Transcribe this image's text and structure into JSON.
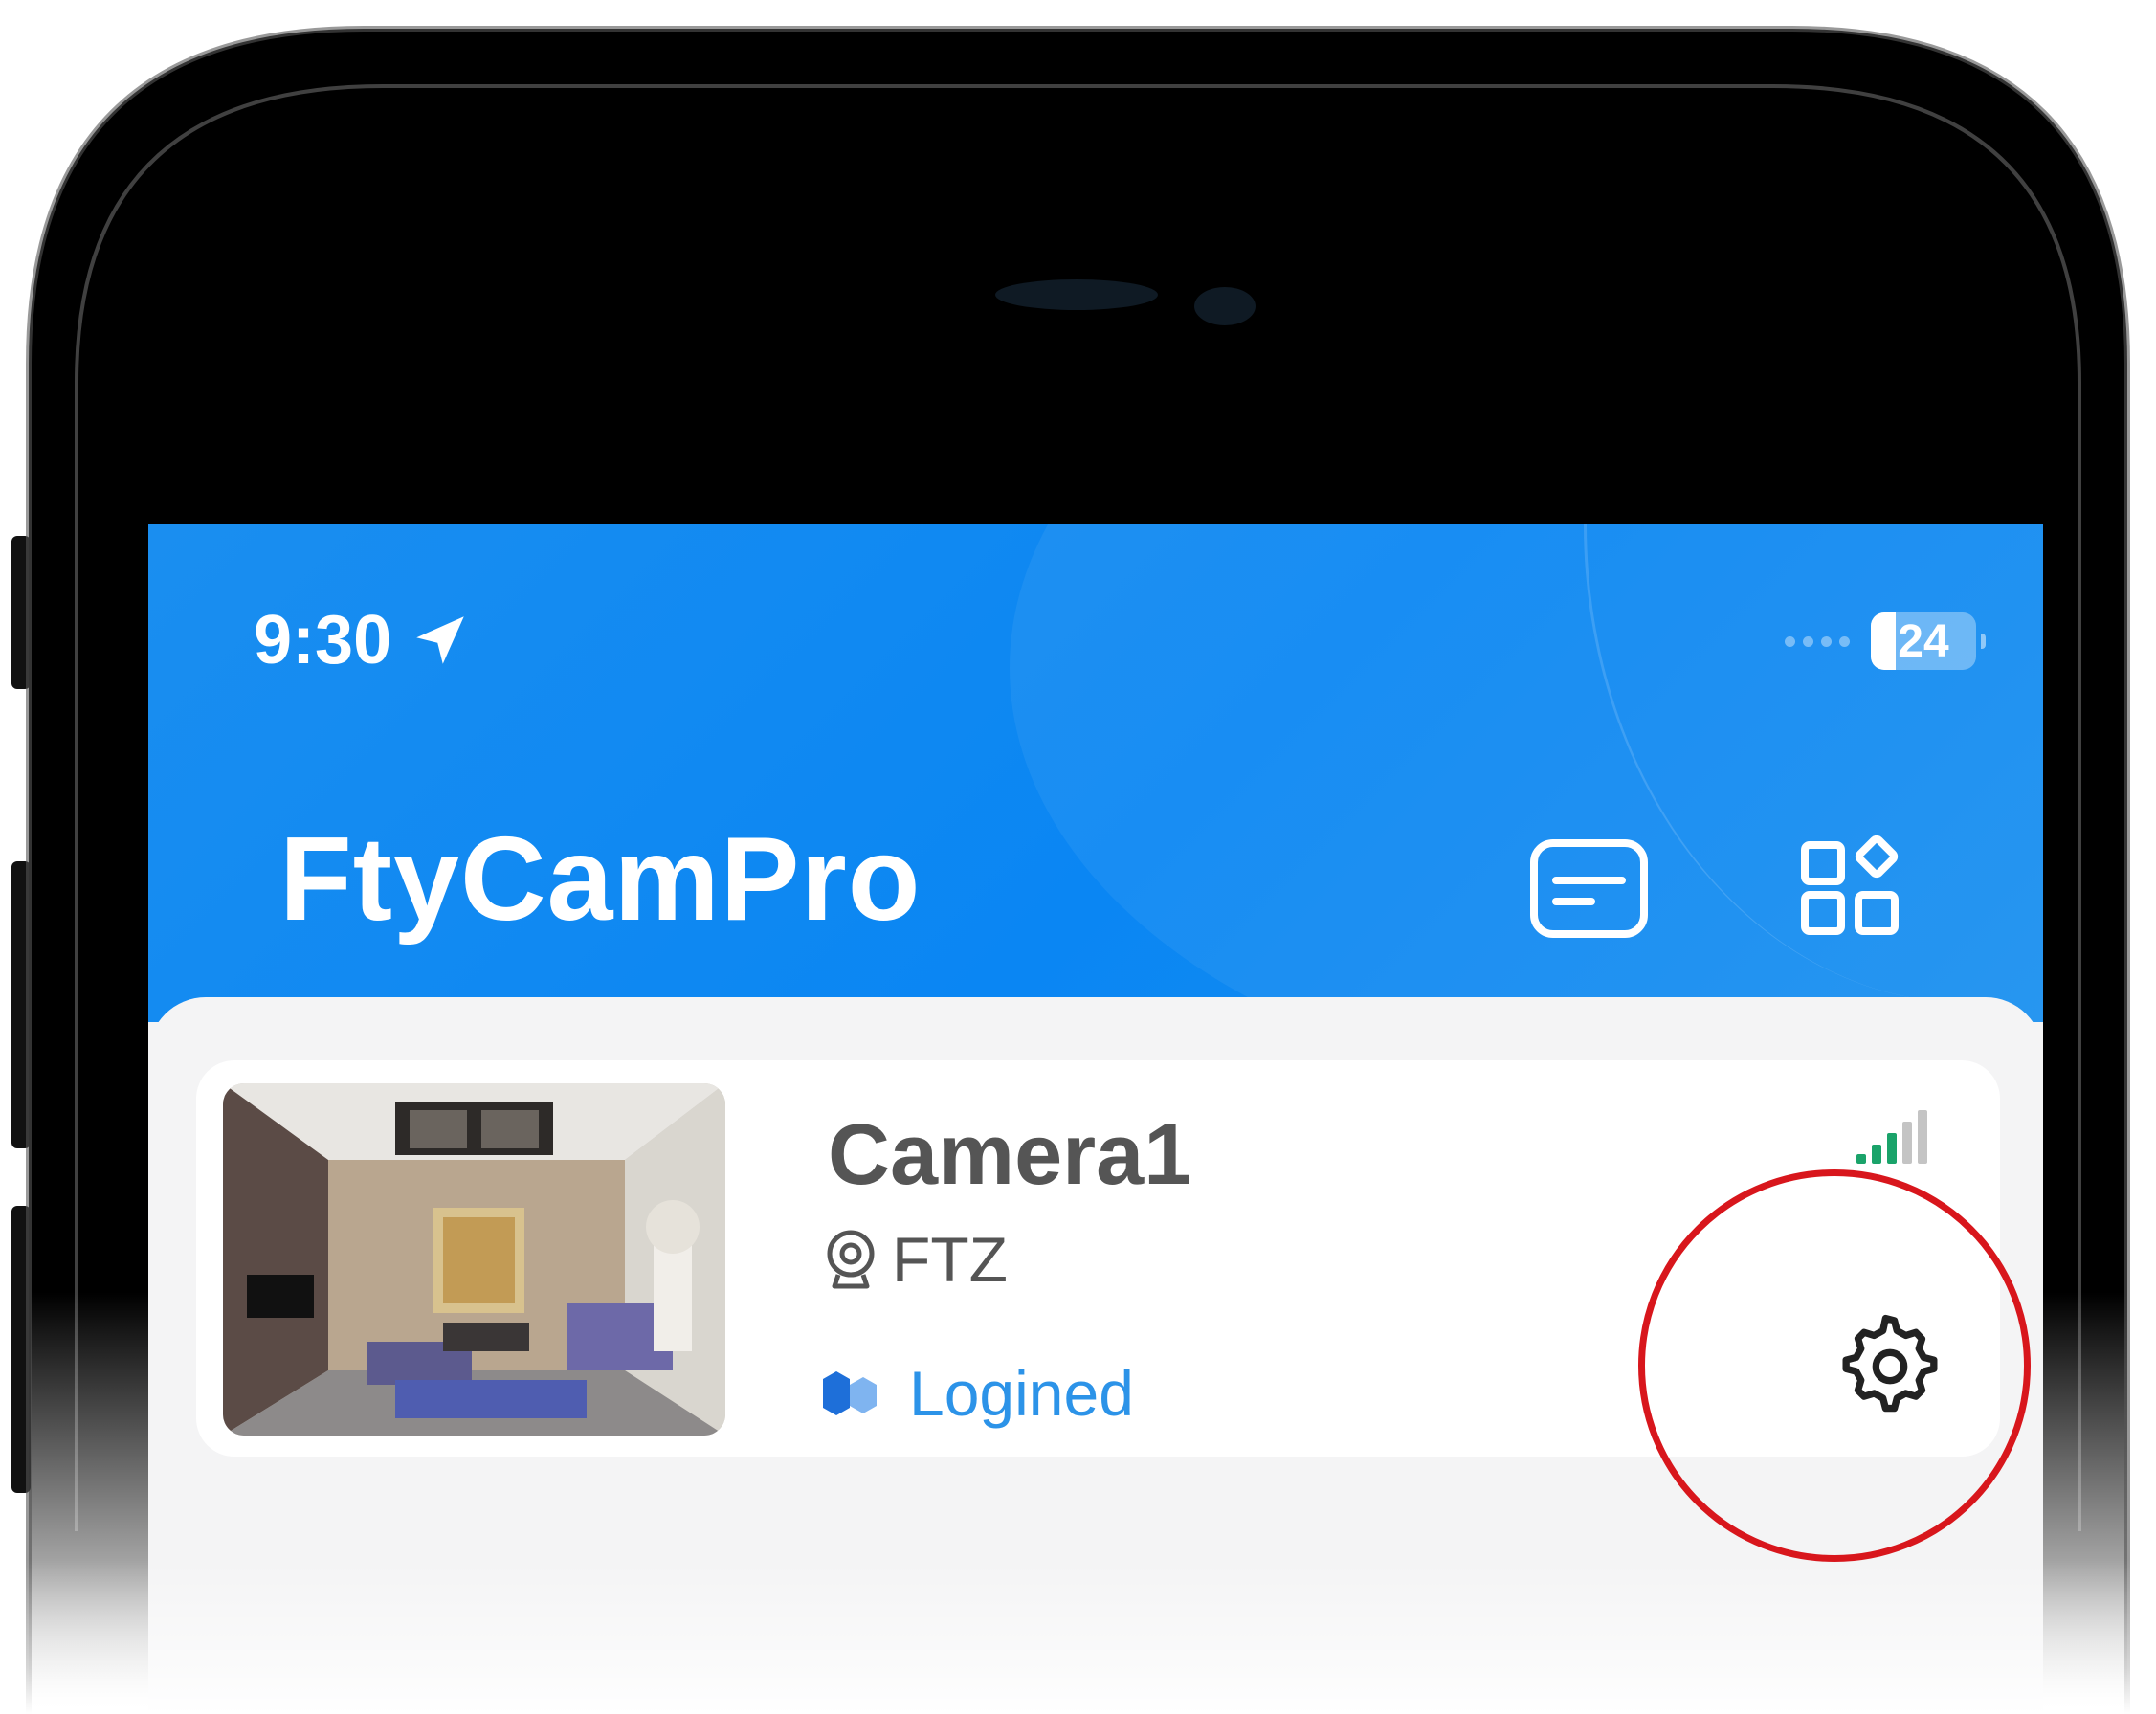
{
  "status_bar": {
    "time": "9:30",
    "battery_level": "24"
  },
  "header": {
    "app_title": "FtyCamPro",
    "message_icon": "message-list-icon",
    "menu_icon": "apps-grid-icon"
  },
  "device": {
    "name": "Camera1",
    "model": "FTZ",
    "status": "Logined",
    "signal_icon": "signal-strength-icon",
    "settings_icon": "gear-icon"
  },
  "colors": {
    "header_blue": "#0a86f3",
    "status_blue": "#2c93e8",
    "highlight_red": "#d8161c",
    "signal_green": "#1aa36a"
  }
}
